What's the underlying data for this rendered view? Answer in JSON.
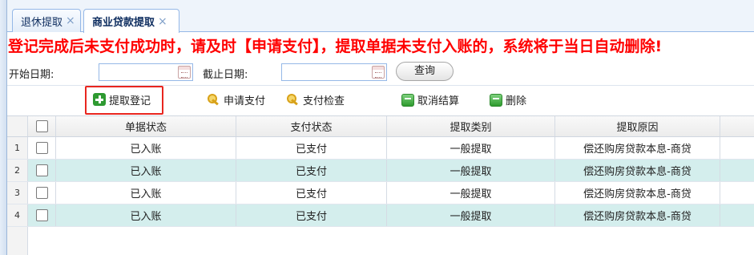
{
  "tabs": [
    {
      "label": "退休提取",
      "active": false
    },
    {
      "label": "商业贷款提取",
      "active": true
    }
  ],
  "tab_close_glyph": "×",
  "warning": "登记完成后未支付成功时，请及时【申请支付】，提取单据未支付入账的，系统将于当日自动删除!",
  "search": {
    "start_label": "开始日期:",
    "start_value": "",
    "end_label": "截止日期:",
    "end_value": "",
    "query_label": "查询"
  },
  "toolbar": {
    "register_label": "提取登记",
    "apply_pay_label": "申请支付",
    "pay_check_label": "支付检查",
    "cancel_settle_label": "取消结算",
    "delete_label": "删除"
  },
  "grid": {
    "columns": [
      "单据状态",
      "支付状态",
      "提取类别",
      "提取原因"
    ],
    "rows": [
      {
        "num": "1",
        "status": "已入账",
        "pay_status": "已支付",
        "category": "一般提取",
        "reason": "偿还购房贷款本息-商贷"
      },
      {
        "num": "2",
        "status": "已入账",
        "pay_status": "已支付",
        "category": "一般提取",
        "reason": "偿还购房贷款本息-商贷"
      },
      {
        "num": "3",
        "status": "已入账",
        "pay_status": "已支付",
        "category": "一般提取",
        "reason": "偿还购房贷款本息-商贷"
      },
      {
        "num": "4",
        "status": "已入账",
        "pay_status": "已支付",
        "category": "一般提取",
        "reason": "偿还购房贷款本息-商贷"
      }
    ]
  },
  "colors": {
    "warning": "#ff0000",
    "alt_row": "#d4eeed",
    "highlight_border": "#e8261f"
  }
}
